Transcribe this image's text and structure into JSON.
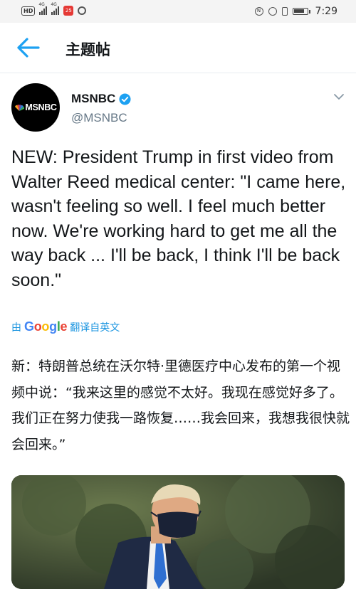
{
  "status_bar": {
    "left_icons": [
      "hd-icon",
      "signal-4g-icon",
      "signal-4g-icon",
      "app-notification-icon",
      "settings-gear-icon"
    ],
    "signal_labels": [
      "4G",
      "4G"
    ],
    "notification_badge": "25",
    "right_icons": [
      "nfc-icon",
      "alarm-icon",
      "vibrate-icon",
      "battery-icon"
    ],
    "time": "7:29"
  },
  "header": {
    "title": "主题帖"
  },
  "tweet": {
    "avatar_text": "MSNBC",
    "author_name": "MSNBC",
    "handle": "@MSNBC",
    "text": "NEW: President Trump in first video from Walter Reed medical center: \"I came here, wasn't feeling so well. I feel much better now. We're working hard to get me all the way back ... I'll be back, I think I'll be back soon.\"",
    "translate": {
      "prefix": "由",
      "brand": "Google",
      "action": "翻译自英文"
    },
    "translation": "新：特朗普总统在沃尔特·里德医疗中心发布的第一个视频中说：“我来这里的感觉不太好。我现在感觉好多了。我们正在努力使我一路恢复……我会回来，我想我很快就会回来。”"
  },
  "colors": {
    "accent": "#1da1f2",
    "link": "#1b95e0",
    "text": "#14171a",
    "secondary": "#657786"
  }
}
